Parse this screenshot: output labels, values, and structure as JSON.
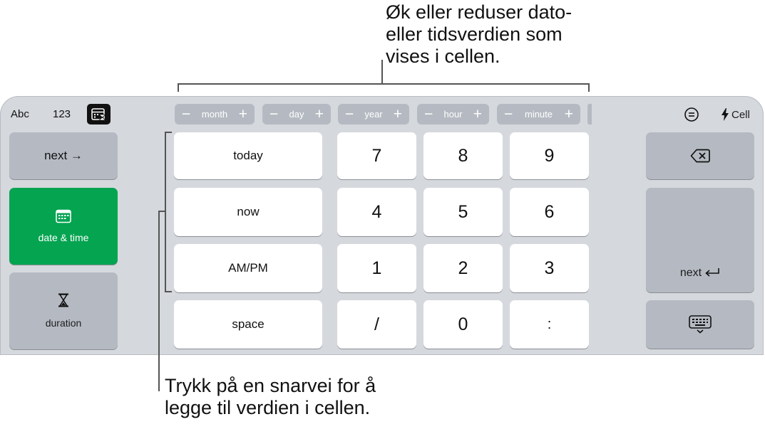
{
  "callouts": {
    "top": [
      "Øk eller reduser dato-",
      "eller tidsverdien som",
      "vises i cellen."
    ],
    "bottom": [
      "Trykk på en snarvei for å",
      "legge til verdien i cellen."
    ]
  },
  "toolbar": {
    "abc": "Abc",
    "num123": "123",
    "steppers": [
      {
        "minus": "−",
        "label": "month",
        "plus": "+"
      },
      {
        "minus": "−",
        "label": "day",
        "plus": "+"
      },
      {
        "minus": "−",
        "label": "year",
        "plus": "+"
      },
      {
        "minus": "−",
        "label": "hour",
        "plus": "+"
      },
      {
        "minus": "−",
        "label": "minute",
        "plus": "+"
      }
    ],
    "cell": "Cell"
  },
  "left": {
    "next": "next →",
    "date_time": "date & time",
    "duration": "duration"
  },
  "shortcuts": [
    "today",
    "now",
    "AM/PM",
    "space"
  ],
  "digits": {
    "r1": [
      "7",
      "8",
      "9"
    ],
    "r2": [
      "4",
      "5",
      "6"
    ],
    "r3": [
      "1",
      "2",
      "3"
    ],
    "r4": [
      "/",
      "0",
      ":"
    ]
  },
  "right": {
    "next_return": "next"
  },
  "colors": {
    "accent_green": "#04a450",
    "keyboard_bg": "#d5d8dd",
    "key_dark": "#b5bac2"
  }
}
